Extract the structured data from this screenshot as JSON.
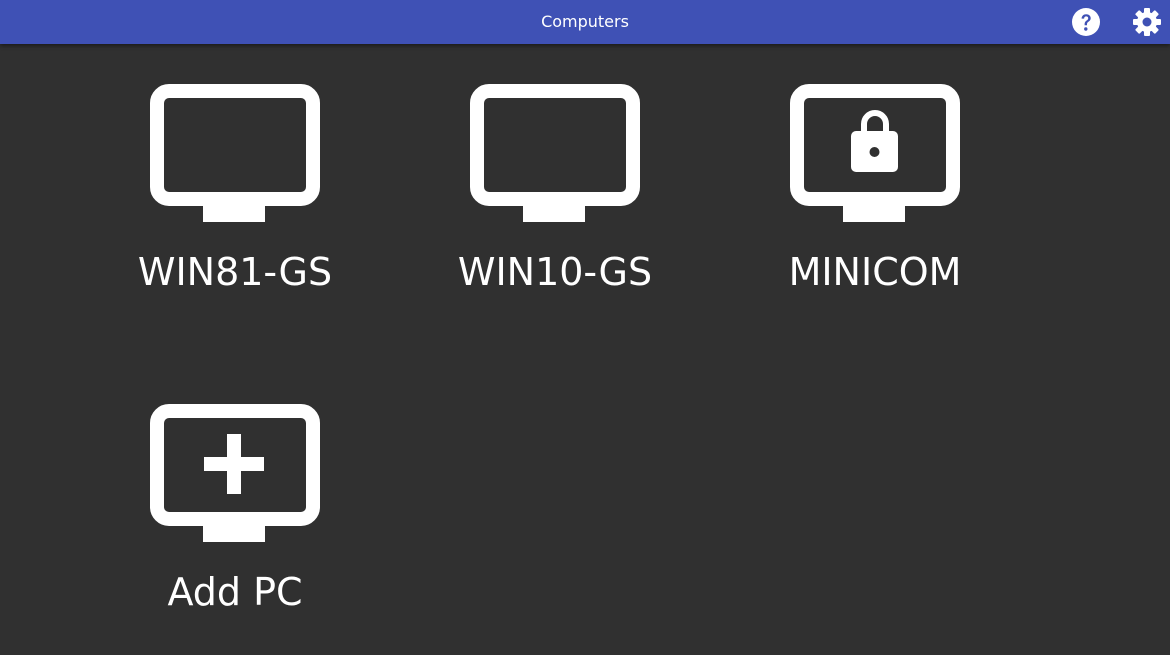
{
  "header": {
    "title": "Computers",
    "help_icon": "help-icon",
    "settings_icon": "gear-icon",
    "background_color": "#3f51b5"
  },
  "main": {
    "background_color": "#303030",
    "computers": [
      {
        "label": "WIN81-GS",
        "icon": "monitor-icon",
        "status": "unlocked"
      },
      {
        "label": "WIN10-GS",
        "icon": "monitor-icon",
        "status": "unlocked"
      },
      {
        "label": "MINICOM",
        "icon": "monitor-lock-icon",
        "status": "locked"
      }
    ],
    "add_pc": {
      "label": "Add PC",
      "icon": "monitor-plus-icon"
    }
  }
}
